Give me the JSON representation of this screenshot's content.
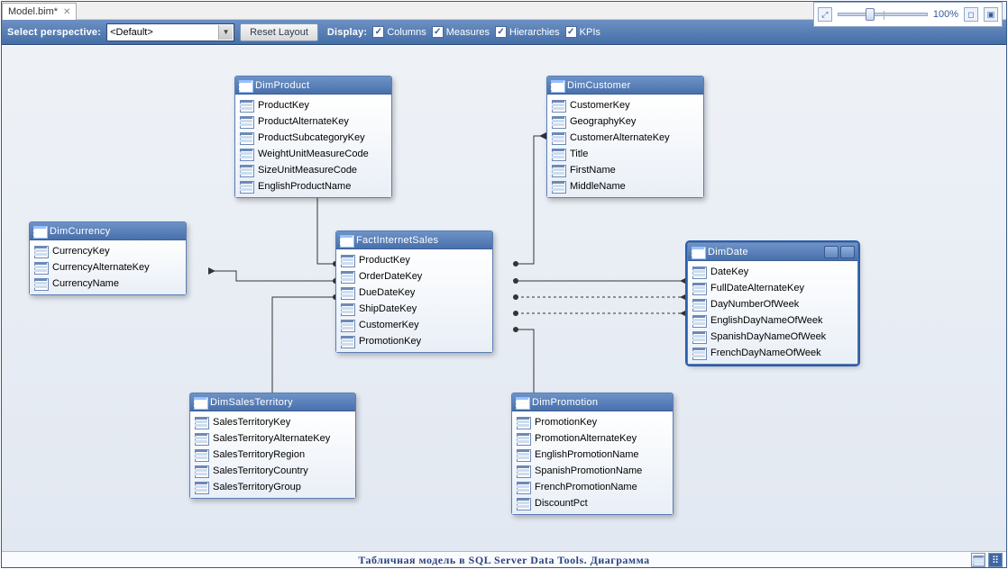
{
  "tab": {
    "title": "Model.bim*"
  },
  "toolbar": {
    "select_perspective_label": "Select perspective:",
    "perspective_value": "<Default>",
    "reset_layout_label": "Reset Layout",
    "display_label": "Display:",
    "checks": {
      "columns": "Columns",
      "measures": "Measures",
      "hierarchies": "Hierarchies",
      "kpis": "KPIs"
    },
    "zoom_value": "100%"
  },
  "tables": {
    "dimProduct": {
      "title": "DimProduct",
      "cols": [
        "ProductKey",
        "ProductAlternateKey",
        "ProductSubcategoryKey",
        "WeightUnitMeasureCode",
        "SizeUnitMeasureCode",
        "EnglishProductName"
      ]
    },
    "dimCustomer": {
      "title": "DimCustomer",
      "cols": [
        "CustomerKey",
        "GeographyKey",
        "CustomerAlternateKey",
        "Title",
        "FirstName",
        "MiddleName"
      ]
    },
    "dimCurrency": {
      "title": "DimCurrency",
      "cols": [
        "CurrencyKey",
        "CurrencyAlternateKey",
        "CurrencyName"
      ]
    },
    "factInternetSales": {
      "title": "FactInternetSales",
      "cols": [
        "ProductKey",
        "OrderDateKey",
        "DueDateKey",
        "ShipDateKey",
        "CustomerKey",
        "PromotionKey"
      ]
    },
    "dimDate": {
      "title": "DimDate",
      "cols": [
        "DateKey",
        "FullDateAlternateKey",
        "DayNumberOfWeek",
        "EnglishDayNameOfWeek",
        "SpanishDayNameOfWeek",
        "FrenchDayNameOfWeek"
      ]
    },
    "dimSalesTerritory": {
      "title": "DimSalesTerritory",
      "cols": [
        "SalesTerritoryKey",
        "SalesTerritoryAlternateKey",
        "SalesTerritoryRegion",
        "SalesTerritoryCountry",
        "SalesTerritoryGroup"
      ]
    },
    "dimPromotion": {
      "title": "DimPromotion",
      "cols": [
        "PromotionKey",
        "PromotionAlternateKey",
        "EnglishPromotionName",
        "SpanishPromotionName",
        "FrenchPromotionName",
        "DiscountPct"
      ]
    }
  },
  "caption": "Табличная модель в SQL Server Data Tools. Диаграмма"
}
